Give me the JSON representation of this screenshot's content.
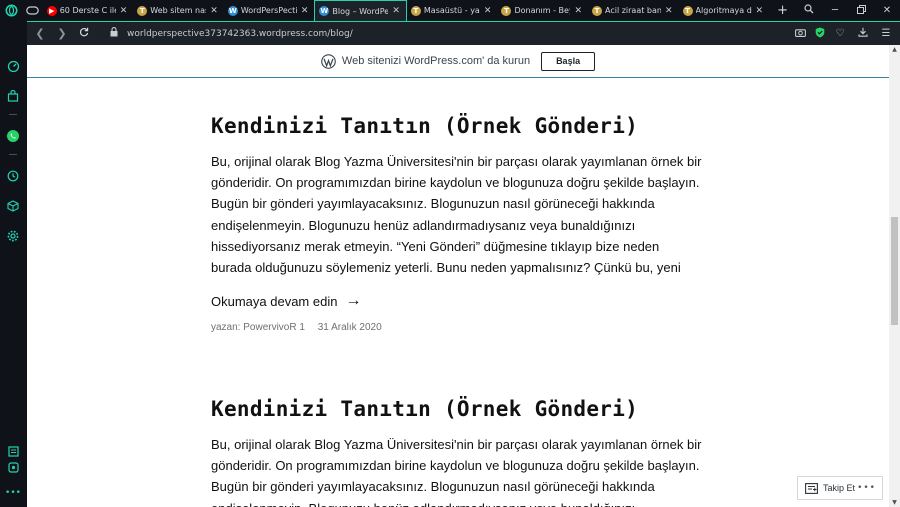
{
  "browser": {
    "tabs": [
      {
        "label": "60 Derste C ile",
        "favicon": "youtube-icon",
        "color": "#ff0000",
        "glyph": "▶",
        "active": false
      },
      {
        "label": "Web sitem nası",
        "favicon": "turkish-site-icon",
        "color": "#c8a646",
        "glyph": "T",
        "active": false
      },
      {
        "label": "WordPersPecti",
        "favicon": "wordpress-icon",
        "color": "#2e8fd6",
        "glyph": "W",
        "active": false
      },
      {
        "label": "Blog – WordPe",
        "favicon": "wordpress-icon",
        "color": "#2e8fd6",
        "glyph": "W",
        "active": true
      },
      {
        "label": "Masaüstü - yar",
        "favicon": "turkish-site-icon",
        "color": "#c8a646",
        "glyph": "T",
        "active": false
      },
      {
        "label": "Donanım - Bey",
        "favicon": "turkish-site-icon",
        "color": "#c8a646",
        "glyph": "T",
        "active": false
      },
      {
        "label": "Acil ziraat ban",
        "favicon": "turkish-site-icon",
        "color": "#c8a646",
        "glyph": "T",
        "active": false
      },
      {
        "label": "Algoritmaya d",
        "favicon": "turkish-site-icon",
        "color": "#c8a646",
        "glyph": "T",
        "active": false
      }
    ],
    "new_tab": "+",
    "url": "worldperspective373742363.wordpress.com/blog/"
  },
  "banner": {
    "text": "Web sitenizi WordPress.com' da kurun",
    "button": "Başla"
  },
  "posts": [
    {
      "title": "Kendinizi Tanıtın (Örnek Gönderi)",
      "body_lines": [
        "Bu, orijinal olarak Blog Yazma Üniversitesi'nin bir parçası olarak yayımlanan örnek bir",
        "gönderidir. On programımızdan birine kaydolun ve blogunuza doğru şekilde başlayın.",
        "Bugün bir gönderi yayımlayacaksınız. Blogunuzun nasıl görüneceği hakkında",
        "endişelenmeyin. Blogunuzu henüz adlandırmadıysanız veya bunaldığınızı",
        "hissediyorsanız merak etmeyin. “Yeni Gönderi” düğmesine tıklayıp bize neden",
        "burada olduğunuzu söylemeniz yeterli. Bunu neden yapmalısınız? Çünkü bu, yeni"
      ],
      "read_more": "Okumaya devam edin",
      "arrow": "→",
      "author": "yazan: PowervivoR 1",
      "date": "31 Aralık 2020"
    },
    {
      "title": "Kendinizi Tanıtın (Örnek Gönderi)",
      "body_lines": [
        "Bu, orijinal olarak Blog Yazma Üniversitesi'nin bir parçası olarak yayımlanan örnek bir",
        "gönderidir. On programımızdan birine kaydolun ve blogunuza doğru şekilde başlayın.",
        "Bugün bir gönderi yayımlayacaksınız. Blogunuzun nasıl görüneceği hakkında",
        "endişelenmeyin. Blogunuzu henüz adlandırmadıysanız veya bunaldığınızı"
      ]
    }
  ],
  "follow_widget": {
    "label": "Takip Et",
    "more": "•••"
  },
  "colors": {
    "accent": "#22d3b0",
    "whatsapp": "#25d366",
    "banner_border": "#3a7fa8"
  }
}
